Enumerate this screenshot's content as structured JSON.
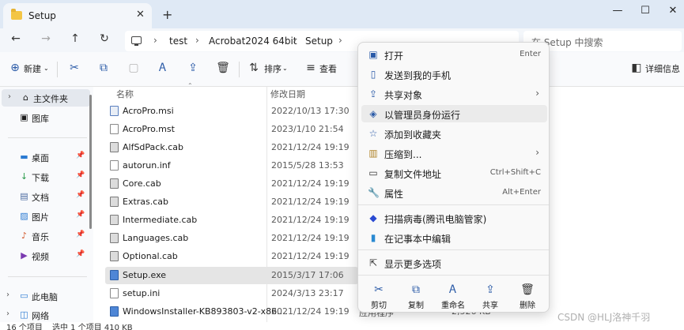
{
  "window": {
    "tab_title": "Setup",
    "tab_close": "✕",
    "new_tab": "+",
    "minimize": "—",
    "maximize": "☐",
    "close": "✕"
  },
  "nav": {
    "back": "←",
    "forward": "→",
    "up": "↑",
    "refresh": "↻",
    "breadcrumbs": [
      "test",
      "Acrobat2024 64bit",
      "Setup"
    ],
    "separator": "›",
    "search_placeholder": "在 Setup 中搜索"
  },
  "toolbar": {
    "new_label": "新建",
    "sort_label": "排序",
    "view_label": "查看",
    "details_label": "详细信息"
  },
  "sidebar": {
    "items": [
      {
        "label": "主文件夹",
        "icon": "home-icon",
        "glyph": "⌂",
        "pinned": false
      },
      {
        "label": "图库",
        "icon": "gallery-icon",
        "glyph": "▣",
        "pinned": false
      },
      {
        "label": "桌面",
        "icon": "desktop-icon",
        "glyph": "▬",
        "pinned": true
      },
      {
        "label": "下载",
        "icon": "download-icon",
        "glyph": "↓",
        "pinned": true
      },
      {
        "label": "文档",
        "icon": "document-icon",
        "glyph": "▤",
        "pinned": true
      },
      {
        "label": "图片",
        "icon": "picture-icon",
        "glyph": "▨",
        "pinned": true
      },
      {
        "label": "音乐",
        "icon": "music-icon",
        "glyph": "♪",
        "pinned": true
      },
      {
        "label": "视频",
        "icon": "video-icon",
        "glyph": "▶",
        "pinned": true
      },
      {
        "label": "此电脑",
        "icon": "this-pc-icon",
        "glyph": "▭",
        "pinned": false
      },
      {
        "label": "网络",
        "icon": "network-icon",
        "glyph": "◫",
        "pinned": false
      }
    ],
    "pin_glyph": "📌"
  },
  "list": {
    "col_name": "名称",
    "col_date": "修改日期",
    "files": [
      {
        "name": "AcroPro.msi",
        "date": "2022/10/13 17:30",
        "type": "",
        "size": "",
        "kind": "msi"
      },
      {
        "name": "AcroPro.mst",
        "date": "2023/1/10 21:54",
        "type": "",
        "size": "",
        "kind": "doc"
      },
      {
        "name": "AlfSdPack.cab",
        "date": "2021/12/24 19:19",
        "type": "",
        "size": "",
        "kind": "cab"
      },
      {
        "name": "autorun.inf",
        "date": "2015/5/28 13:53",
        "type": "",
        "size": "",
        "kind": "doc"
      },
      {
        "name": "Core.cab",
        "date": "2021/12/24 19:19",
        "type": "",
        "size": "",
        "kind": "cab"
      },
      {
        "name": "Extras.cab",
        "date": "2021/12/24 19:19",
        "type": "",
        "size": "",
        "kind": "cab"
      },
      {
        "name": "Intermediate.cab",
        "date": "2021/12/24 19:19",
        "type": "",
        "size": "",
        "kind": "cab"
      },
      {
        "name": "Languages.cab",
        "date": "2021/12/24 19:19",
        "type": "",
        "size": "",
        "kind": "cab"
      },
      {
        "name": "Optional.cab",
        "date": "2021/12/24 19:19",
        "type": "",
        "size": "",
        "kind": "cab"
      },
      {
        "name": "Setup.exe",
        "date": "2015/3/17 17:06",
        "type": "",
        "size": "",
        "kind": "exe"
      },
      {
        "name": "setup.ini",
        "date": "2024/3/13 23:17",
        "type": "",
        "size": "",
        "kind": "doc"
      },
      {
        "name": "WindowsInstaller-KB893803-v2-x86....",
        "date": "2021/12/24 19:19",
        "type": "应用程序",
        "size": "2,526 KB",
        "kind": "exe"
      }
    ]
  },
  "status": {
    "count": "16 个项目",
    "selection": "选中 1 个项目  410 KB"
  },
  "context_menu": {
    "items": [
      {
        "label": "打开",
        "shortcut": "Enter",
        "icon": "open-icon",
        "glyph": "▣",
        "arrow": ""
      },
      {
        "label": "发送到我的手机",
        "shortcut": "",
        "icon": "phone-icon",
        "glyph": "▯",
        "arrow": ""
      },
      {
        "label": "共享对象",
        "shortcut": "",
        "icon": "share-icon",
        "glyph": "⇪",
        "arrow": "›"
      },
      {
        "label": "以管理员身份运行",
        "shortcut": "",
        "icon": "shield-icon",
        "glyph": "◈",
        "arrow": ""
      },
      {
        "label": "添加到收藏夹",
        "shortcut": "",
        "icon": "star-icon",
        "glyph": "☆",
        "arrow": ""
      },
      {
        "label": "压缩到...",
        "shortcut": "",
        "icon": "zip-icon",
        "glyph": "▥",
        "arrow": "›"
      },
      {
        "label": "复制文件地址",
        "shortcut": "Ctrl+Shift+C",
        "icon": "path-icon",
        "glyph": "▭",
        "arrow": ""
      },
      {
        "label": "属性",
        "shortcut": "Alt+Enter",
        "icon": "wrench-icon",
        "glyph": "🔧",
        "arrow": ""
      },
      {
        "label": "扫描病毒(腾讯电脑管家)",
        "shortcut": "",
        "icon": "antivirus-icon",
        "glyph": "◆",
        "arrow": ""
      },
      {
        "label": "在记事本中编辑",
        "shortcut": "",
        "icon": "notepad-icon",
        "glyph": "▮",
        "arrow": ""
      },
      {
        "label": "显示更多选项",
        "shortcut": "",
        "icon": "more-options-icon",
        "glyph": "⇱",
        "arrow": ""
      }
    ],
    "bottom": [
      {
        "label": "剪切",
        "icon": "cut-icon",
        "glyph": "✂"
      },
      {
        "label": "复制",
        "icon": "copy-icon",
        "glyph": "⧉"
      },
      {
        "label": "重命名",
        "icon": "rename-icon",
        "glyph": "Ꭺ"
      },
      {
        "label": "共享",
        "icon": "share-icon",
        "glyph": "⇪"
      },
      {
        "label": "删除",
        "icon": "trash-icon",
        "glyph": "🗑"
      }
    ]
  },
  "watermark": "CSDN @HLJ洛神千羽"
}
